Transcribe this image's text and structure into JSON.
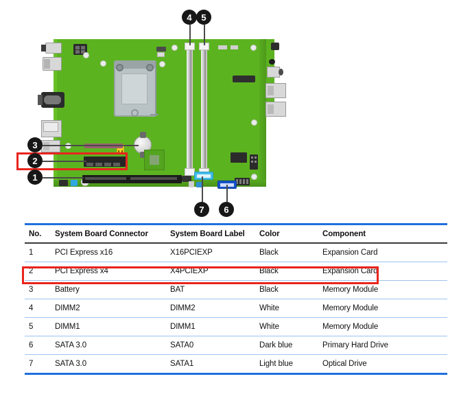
{
  "diagram": {
    "alt": "HP system board layout with numbered callouts",
    "board_color": "#5cb320",
    "highlight_color": "#e8241d",
    "callouts": [
      {
        "id": "1",
        "label": "1",
        "target": "PCI Express x16 slot"
      },
      {
        "id": "2",
        "label": "2",
        "target": "PCI Express x4 slot"
      },
      {
        "id": "3",
        "label": "3",
        "target": "Battery"
      },
      {
        "id": "4",
        "label": "4",
        "target": "DIMM2"
      },
      {
        "id": "5",
        "label": "5",
        "target": "DIMM1"
      },
      {
        "id": "6",
        "label": "6",
        "target": "SATA0"
      },
      {
        "id": "7",
        "label": "7",
        "target": "SATA1"
      }
    ]
  },
  "table": {
    "accent_color": "#1f6fe0",
    "highlight_color": "#e8241d",
    "highlighted_row_index": 1,
    "columns": [
      "No.",
      "System Board Connector",
      "System Board Label",
      "Color",
      "Component"
    ],
    "rows": [
      {
        "no": "1",
        "connector": "PCI Express x16",
        "label": "X16PCIEXP",
        "color": "Black",
        "component": "Expansion Card"
      },
      {
        "no": "2",
        "connector": "PCI Express x4",
        "label": "X4PCIEXP",
        "color": "Black",
        "component": "Expansion Card"
      },
      {
        "no": "3",
        "connector": "Battery",
        "label": "BAT",
        "color": "Black",
        "component": "Memory Module"
      },
      {
        "no": "4",
        "connector": "DIMM2",
        "label": "DIMM2",
        "color": "White",
        "component": "Memory Module"
      },
      {
        "no": "5",
        "connector": "DIMM1",
        "label": "DIMM1",
        "color": "White",
        "component": "Memory Module"
      },
      {
        "no": "6",
        "connector": "SATA 3.0",
        "label": "SATA0",
        "color": "Dark blue",
        "component": "Primary Hard Drive"
      },
      {
        "no": "7",
        "connector": "SATA 3.0",
        "label": "SATA1",
        "color": "Light blue",
        "component": "Optical Drive"
      }
    ]
  }
}
